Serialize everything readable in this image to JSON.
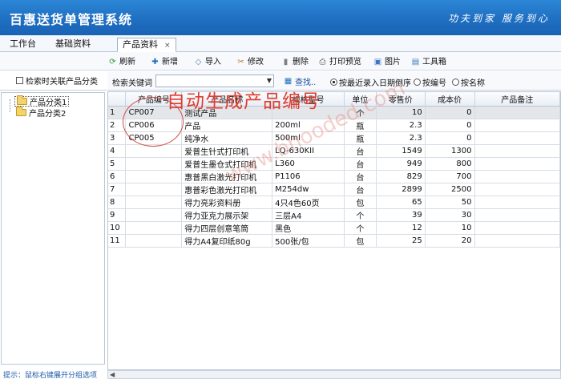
{
  "app": {
    "title": "百惠送货单管理系统",
    "slogan": "功夫到家 服务到心"
  },
  "tabs": [
    {
      "label": "工作台"
    },
    {
      "label": "基础资料"
    },
    {
      "label": "产品资料",
      "close": "×"
    }
  ],
  "toolbar": {
    "refresh": "刷新",
    "add": "新增",
    "import": "导入",
    "edit": "修改",
    "delete": "删除",
    "print_preview": "打印预览",
    "image": "图片",
    "toolbox": "工具箱"
  },
  "left_panel": {
    "checkbox_label": "检索时关联产品分类",
    "tree": [
      "产品分类1",
      "产品分类2"
    ],
    "hint": "提示：鼠标右键展开分组选项"
  },
  "search": {
    "label": "检索关键词",
    "value": "",
    "button": "查找..",
    "sort_options": [
      "按最近录入日期倒序",
      "按编号",
      "按名称"
    ],
    "sort_selected": "按最近录入日期倒序"
  },
  "grid": {
    "columns": [
      "",
      "产品编号",
      "产品名称",
      "规格型号",
      "单位",
      "零售价",
      "成本价",
      "产品备注"
    ],
    "rows": [
      [
        "1",
        "CP007",
        "测试产品",
        "",
        "个",
        "10",
        "0",
        ""
      ],
      [
        "2",
        "CP006",
        "产品",
        "200ml",
        "瓶",
        "2.3",
        "0",
        ""
      ],
      [
        "3",
        "CP005",
        "纯净水",
        "500ml",
        "瓶",
        "2.3",
        "0",
        ""
      ],
      [
        "4",
        "",
        "爱普生针式打印机",
        "LQ-630KII",
        "台",
        "1549",
        "1300",
        ""
      ],
      [
        "5",
        "",
        "爱普生墨仓式打印机",
        "L360",
        "台",
        "949",
        "800",
        ""
      ],
      [
        "6",
        "",
        "惠普黑白激光打印机",
        "P1106",
        "台",
        "829",
        "700",
        ""
      ],
      [
        "7",
        "",
        "惠普彩色激光打印机",
        "M254dw",
        "台",
        "2899",
        "2500",
        ""
      ],
      [
        "8",
        "",
        "得力亮彩资料册",
        "4只4色60页",
        "包",
        "65",
        "50",
        ""
      ],
      [
        "9",
        "",
        "得力亚克力展示架",
        "三层A4",
        "个",
        "39",
        "30",
        ""
      ],
      [
        "10",
        "",
        "得力四层创意笔筒",
        "黑色",
        "个",
        "12",
        "10",
        ""
      ],
      [
        "11",
        "",
        "得力A4复印纸80g",
        "500张/包",
        "包",
        "25",
        "20",
        ""
      ]
    ]
  },
  "annotation": {
    "text": "自动生成产品编号",
    "watermark": "www.bhooded.com"
  },
  "colors": {
    "titlebar": "#1f6fc2",
    "annotation": "#e03c2f"
  }
}
